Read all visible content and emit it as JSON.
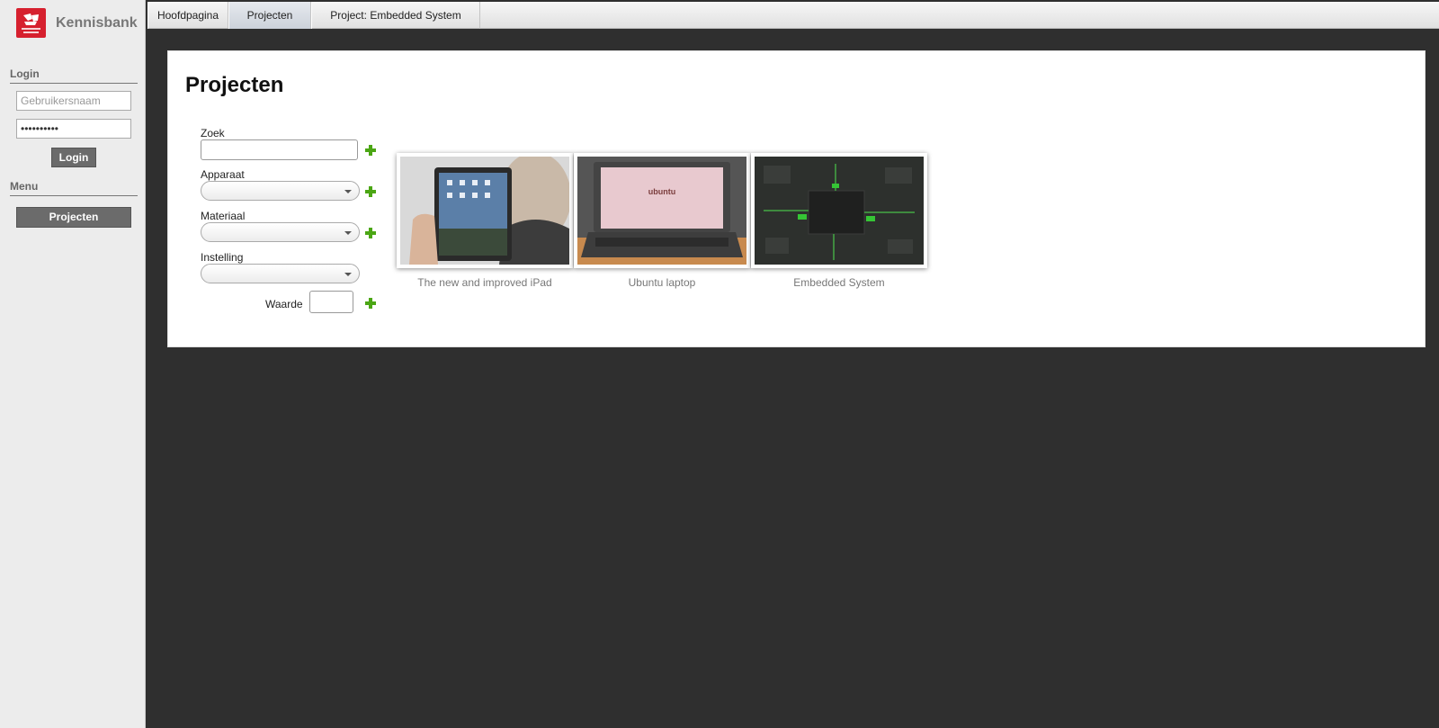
{
  "app": {
    "name": "Kennisbank"
  },
  "login": {
    "title": "Login",
    "username_placeholder": "Gebruikersnaam",
    "password_value": "••••••••••",
    "button_label": "Login"
  },
  "menu": {
    "title": "Menu",
    "items": [
      {
        "label": "Projecten"
      }
    ]
  },
  "tabs": [
    {
      "label": "Hoofdpagina",
      "active": false
    },
    {
      "label": "Projecten",
      "active": true
    },
    {
      "label": "Project: Embedded System",
      "active": false
    }
  ],
  "main": {
    "title": "Projecten",
    "filters": {
      "zoek_label": "Zoek",
      "apparaat_label": "Apparaat",
      "materiaal_label": "Materiaal",
      "instelling_label": "Instelling",
      "waarde_label": "Waarde"
    },
    "projects": [
      {
        "caption": "The new and improved iPad",
        "image": "ipad-photo"
      },
      {
        "caption": "Ubuntu laptop",
        "image": "laptop-photo",
        "screen_text": "ubuntu"
      },
      {
        "caption": "Embedded System",
        "image": "circuit-board-photo"
      }
    ]
  },
  "colors": {
    "brand_red": "#d6202e",
    "plus_green": "#4ba614",
    "background_dark": "#2f2f2f"
  }
}
